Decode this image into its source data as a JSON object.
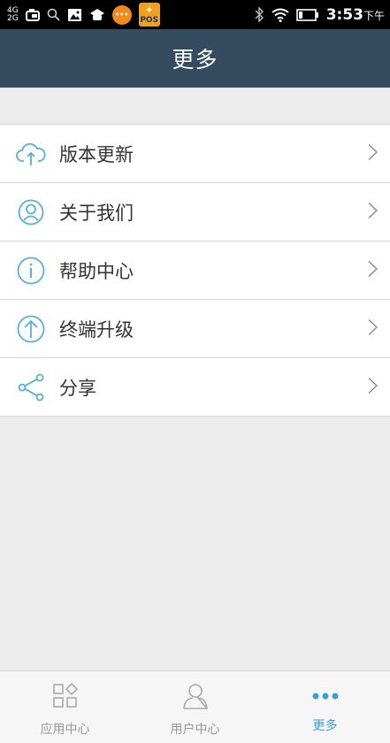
{
  "statusbar": {
    "network_top": "4G",
    "network_bottom": "2G",
    "time": "3:53",
    "time_suffix": "下午",
    "pos_label": "POS",
    "icons": [
      "signal-icon",
      "camera-icon",
      "search-icon",
      "image-icon",
      "hat-icon",
      "app-icon",
      "pos-app-icon",
      "bluetooth-icon",
      "wifi-icon",
      "battery-icon"
    ]
  },
  "header": {
    "title": "更多"
  },
  "menu": {
    "items": [
      {
        "label": "版本更新",
        "icon": "cloud-upload-icon"
      },
      {
        "label": "关于我们",
        "icon": "user-circle-icon"
      },
      {
        "label": "帮助中心",
        "icon": "info-icon"
      },
      {
        "label": "终端升级",
        "icon": "arrow-up-circle-icon"
      },
      {
        "label": "分享",
        "icon": "share-icon"
      }
    ]
  },
  "tabbar": {
    "tabs": [
      {
        "label": "应用中心",
        "icon": "grid-icon",
        "active": false
      },
      {
        "label": "用户中心",
        "icon": "user-icon",
        "active": false
      },
      {
        "label": "更多",
        "icon": "more-dots-icon",
        "active": true
      }
    ]
  },
  "colors": {
    "header_bg": "#344b60",
    "icon_blue": "#5aaed8",
    "active_tab": "#3b9ed4",
    "page_bg": "#ececec"
  }
}
